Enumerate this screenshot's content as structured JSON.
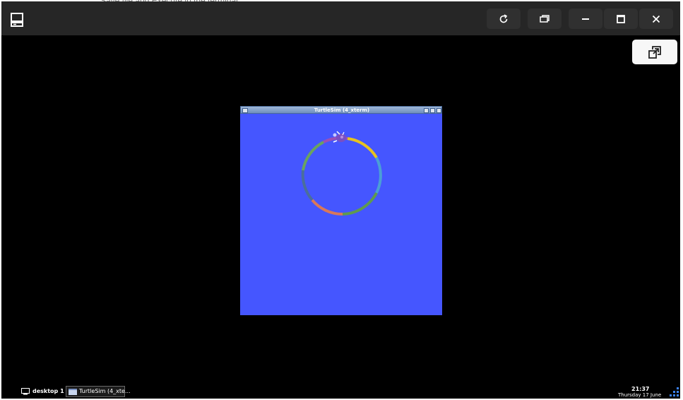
{
  "background_window": {
    "peek_text": "Save file and Execute in the terminal"
  },
  "viewer": {
    "header": {
      "app_icon": "computer-icon",
      "buttons": [
        {
          "name": "reload-button",
          "icon": "reload-icon"
        },
        {
          "name": "switch-window-button",
          "icon": "window-switch-icon"
        },
        {
          "name": "minimize-button",
          "icon": "minimize-icon"
        },
        {
          "name": "maximize-button",
          "icon": "maximize-icon"
        },
        {
          "name": "close-button",
          "icon": "close-icon"
        }
      ]
    },
    "popout_button": {
      "icon": "popout-icon"
    }
  },
  "turtlesim": {
    "title": "TurtleSim (4_xterm)",
    "background_color": "#4556ff",
    "trail_colors": [
      "#e8c31f",
      "#4b9fd6",
      "#5f9a4e",
      "#d9785a",
      "#4a6e9c",
      "#6aa35f",
      "#9b4fb5"
    ]
  },
  "taskbar": {
    "desktop_label": "desktop 1",
    "task_label": "TurtleSim (4_xte...",
    "clock_time": "21:37",
    "clock_date": "Thursday 17 June"
  },
  "colors": {
    "header_bg": "#262626",
    "desktop_bg": "#000000",
    "accent_blue": "#3b82f6"
  }
}
